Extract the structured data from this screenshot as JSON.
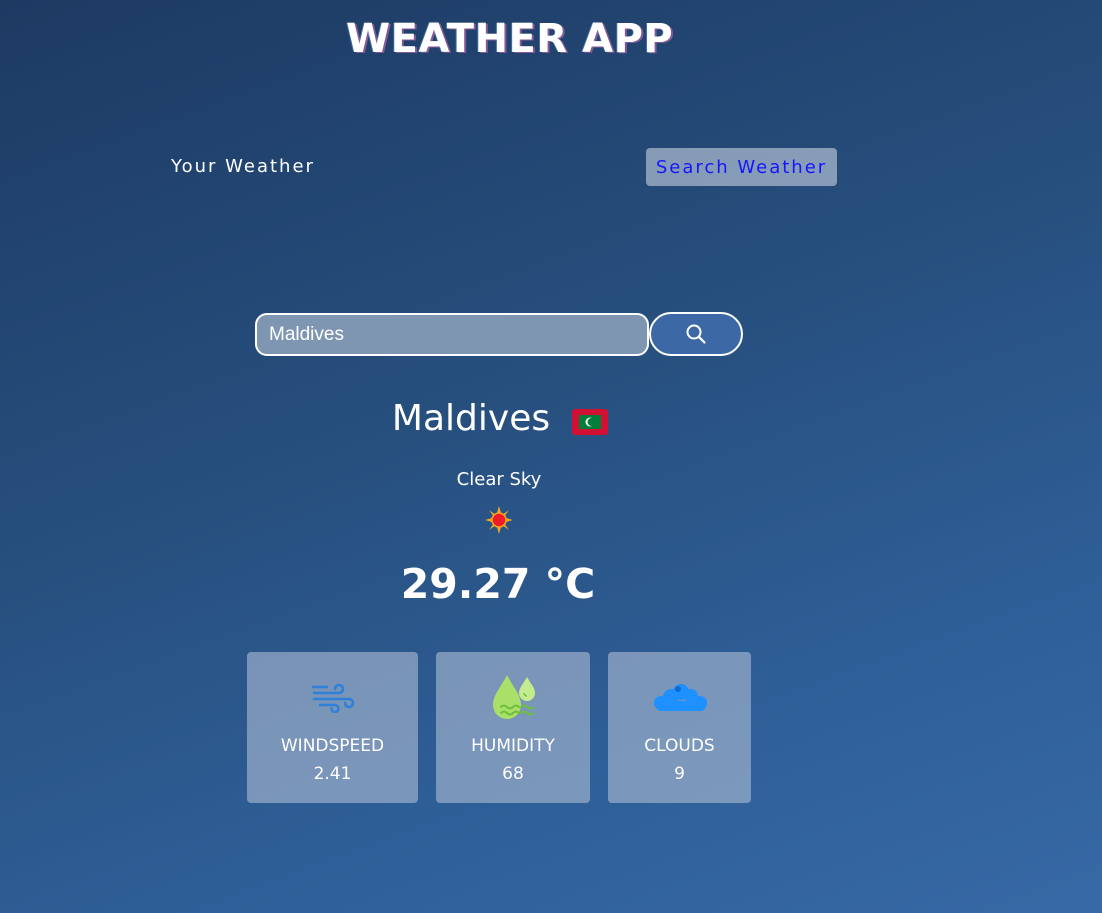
{
  "header": {
    "title": "WEATHER APP"
  },
  "tabs": {
    "your_weather": "Your Weather",
    "search_weather": "Search Weather"
  },
  "search": {
    "value": "Maldives"
  },
  "location": {
    "city": "Maldives",
    "flag_icon": "maldives-flag-icon"
  },
  "weather": {
    "description": "Clear Sky",
    "icon": "sun-icon",
    "temperature": "29.27 °C"
  },
  "cards": {
    "windspeed": {
      "label": "WINDSPEED",
      "value": "2.41",
      "icon": "wind-icon"
    },
    "humidity": {
      "label": "HUMIDITY",
      "value": "68",
      "icon": "humidity-icon"
    },
    "clouds": {
      "label": "CLOUDS",
      "value": "9",
      "icon": "clouds-icon"
    }
  },
  "colors": {
    "background_top": "#1d3a63",
    "background_bottom": "#3769a6",
    "search_tab_text": "#1515ff",
    "card_bg": "#a9b9d2"
  }
}
